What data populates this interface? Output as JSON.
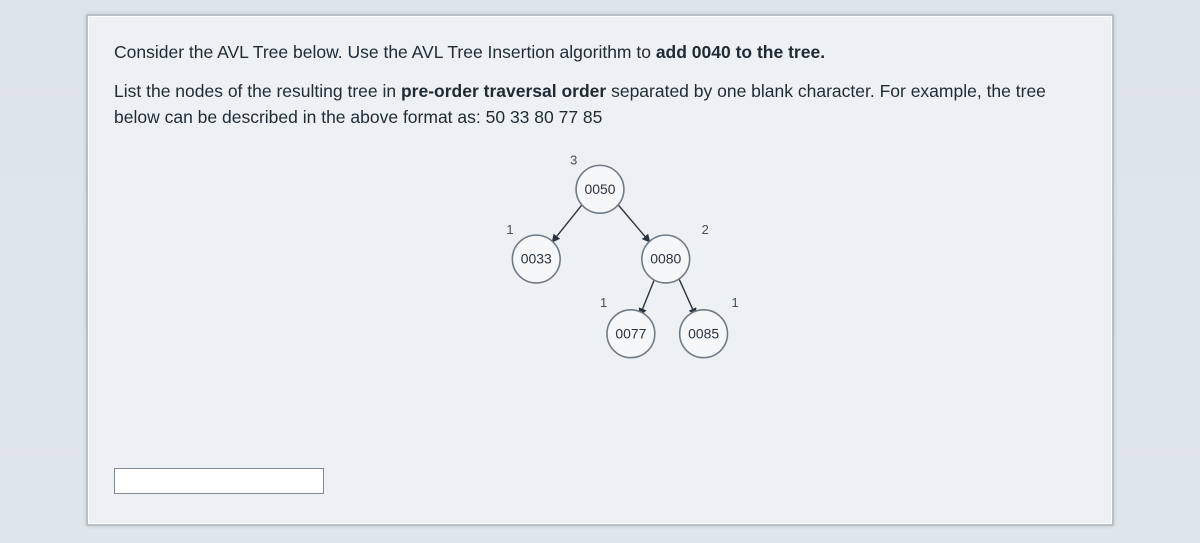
{
  "question": {
    "intro_part1": "Consider the AVL Tree below.  Use the AVL Tree Insertion algorithm  to ",
    "intro_bold1": "add 0040 to the tree.",
    "para2_part1": "List the nodes of the resulting tree in ",
    "para2_bold": "pre-order traversal order",
    "para2_part2": " separated by one blank character. For example, the tree below can be described in the above format as:  50 33 80 77 85"
  },
  "tree": {
    "heights": {
      "root": "3",
      "left": "1",
      "right": "2",
      "right_left": "1",
      "right_right": "1"
    },
    "nodes": {
      "root": "0050",
      "left": "0033",
      "right": "0080",
      "right_left": "0077",
      "right_right": "0085"
    }
  },
  "answer": {
    "value": "",
    "placeholder": ""
  }
}
